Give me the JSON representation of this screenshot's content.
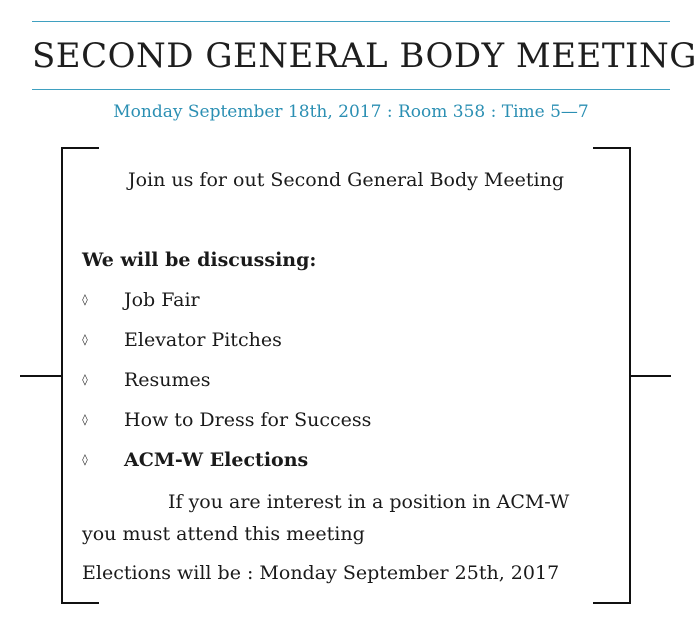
{
  "header": {
    "title": "SECOND GENERAL BODY MEETING",
    "subtitle": "Monday September 18th, 2017 : Room 358 : Time 5—7"
  },
  "body": {
    "intro": "Join us for out Second General Body Meeting",
    "discussing_heading": "We will be discussing:",
    "bullet_glyph": "◊",
    "agenda": [
      {
        "label": "Job Fair",
        "bold": false
      },
      {
        "label": "Elevator Pitches",
        "bold": false
      },
      {
        "label": "Resumes",
        "bold": false
      },
      {
        "label": "How to Dress for Success",
        "bold": false
      },
      {
        "label": "ACM-W Elections",
        "bold": true
      }
    ],
    "note_line1": "If you are interest in a position in ACM-W",
    "note_line2": "you must attend this meeting",
    "elections": "Elections will be : Monday September 25th, 2017"
  },
  "colors": {
    "accent": "#2b8fb3",
    "rule": "#3fa0c0",
    "text": "#1a1a1a"
  }
}
